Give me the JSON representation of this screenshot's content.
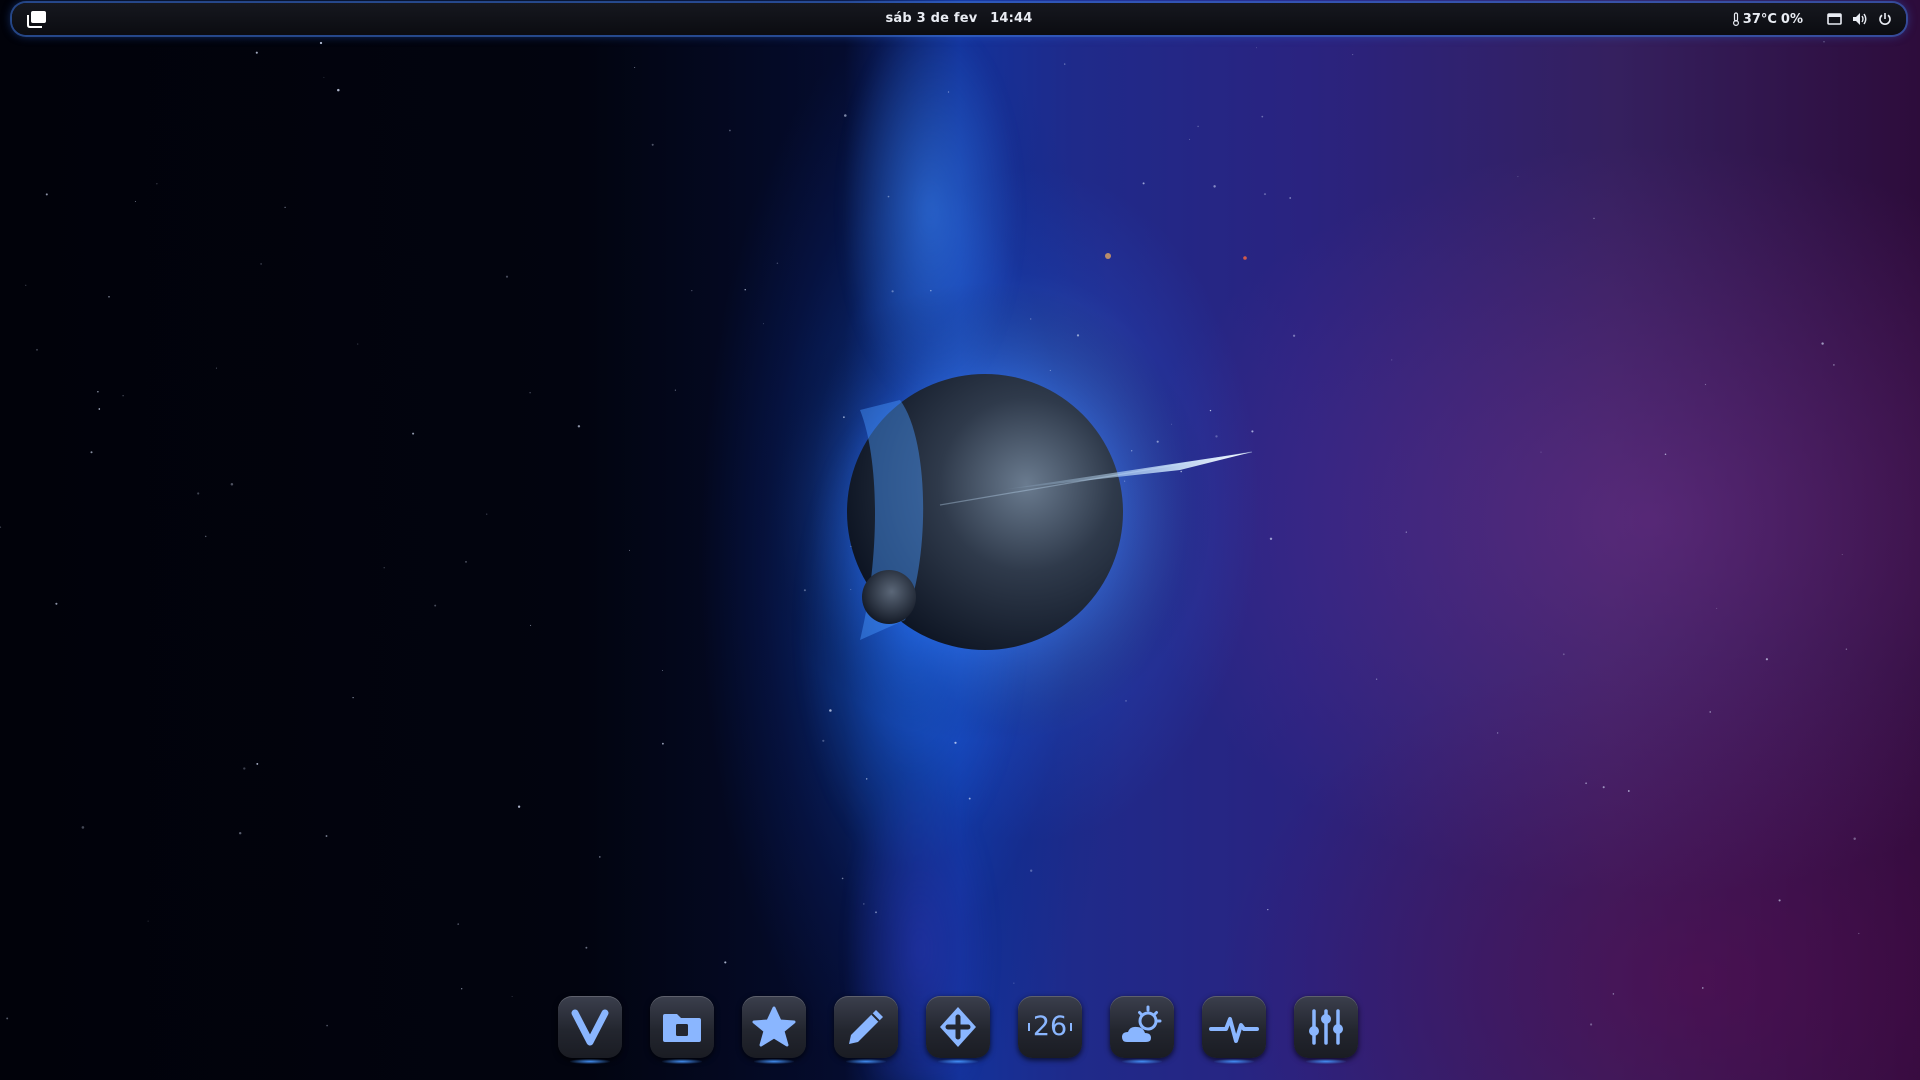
{
  "topbar": {
    "activities_icon": "window-overview-icon",
    "date": "sáb 3 de fev",
    "time": "14:44",
    "temperature": "37°C",
    "cpu_usage": "0%",
    "tray_icons": [
      "thermometer-icon",
      "display-icon",
      "volume-icon",
      "power-icon"
    ]
  },
  "dock": {
    "apps": [
      {
        "name": "Vivaldi",
        "icon": "vivaldi-icon"
      },
      {
        "name": "Files",
        "icon": "folder-icon"
      },
      {
        "name": "Favorites",
        "icon": "star-icon"
      },
      {
        "name": "Text Editor",
        "icon": "pencil-icon"
      },
      {
        "name": "Software",
        "icon": "app-store-icon"
      },
      {
        "name": "Calendar",
        "icon": "calendar-icon",
        "day": "26"
      },
      {
        "name": "Weather",
        "icon": "weather-icon"
      },
      {
        "name": "System Monitor",
        "icon": "system-monitor-icon"
      },
      {
        "name": "Settings",
        "icon": "equalizer-icon"
      }
    ]
  },
  "colors": {
    "accent": "#4a90ff",
    "icon_fill": "#8ab6ff",
    "topbar_bg": "#101218",
    "topbar_text": "#e9ecf3"
  }
}
